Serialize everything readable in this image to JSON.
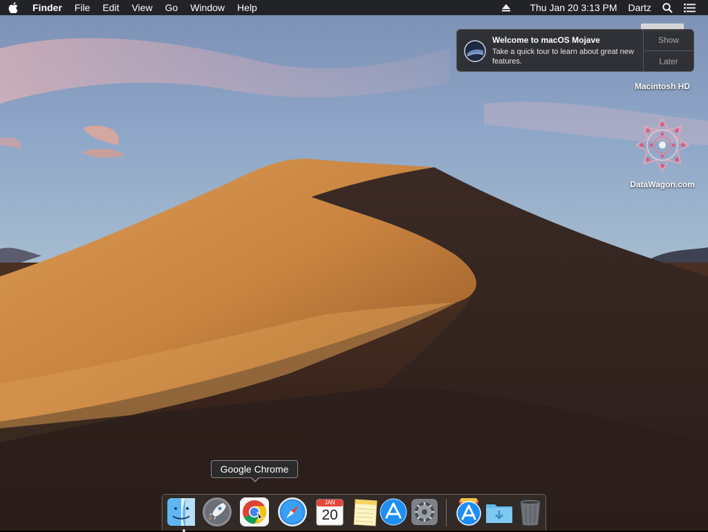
{
  "menubar": {
    "apple_icon": "apple-logo-icon",
    "app_name": "Finder",
    "menus": [
      "File",
      "Edit",
      "View",
      "Go",
      "Window",
      "Help"
    ],
    "eject_icon": "eject-icon",
    "clock": "Thu Jan 20  3:13 PM",
    "user": "Dartz",
    "search_icon": "spotlight-search-icon",
    "list_icon": "notification-center-icon"
  },
  "notification": {
    "title": "Welcome to macOS Mojave",
    "body": "Take a quick tour to learn about great new features.",
    "show_label": "Show",
    "later_label": "Later"
  },
  "desktop_icons": {
    "hd_label": "Macintosh HD",
    "datawagon_label": "DataWagon.com"
  },
  "tooltip": {
    "text": "Google Chrome"
  },
  "dock": {
    "calendar_month": "JAN",
    "calendar_day": "20",
    "items": [
      "Finder",
      "Launchpad",
      "Google Chrome",
      "Safari",
      "Calendar",
      "Notes",
      "App Store",
      "System Preferences",
      "Downloads",
      "Documents",
      "Trash"
    ]
  }
}
